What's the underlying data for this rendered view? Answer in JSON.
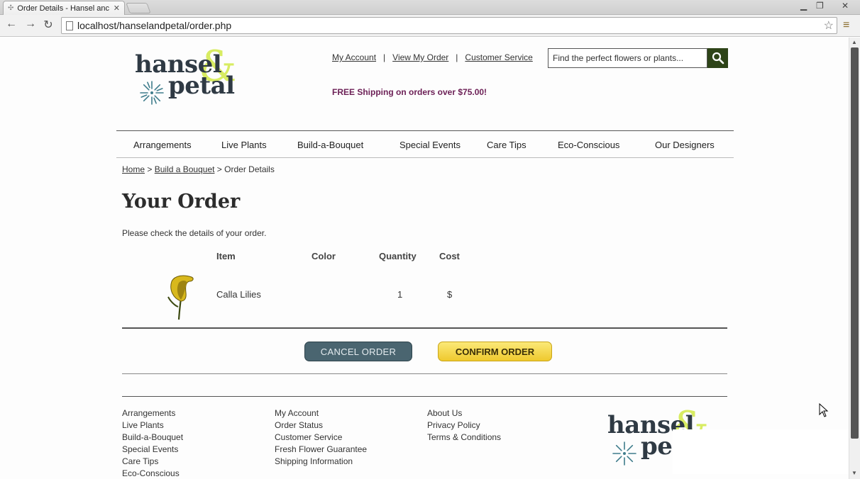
{
  "browser": {
    "tab_title": "Order Details - Hansel anc",
    "url": "localhost/hanselandpetal/order.php",
    "icons": [
      "back-arrow-icon",
      "forward-arrow-icon",
      "reload-icon",
      "star-icon",
      "menu-icon"
    ]
  },
  "header": {
    "logo": {
      "word1": "hansel",
      "ampersand": "&",
      "word2": "petal"
    },
    "links": [
      "My Account",
      "View My Order",
      "Customer Service"
    ],
    "separator": "|",
    "search_placeholder": "Find the perfect flowers or plants...",
    "promo": "FREE Shipping on orders over $75.00!"
  },
  "nav": {
    "items": [
      "Arrangements",
      "Live Plants",
      "Build-a-Bouquet",
      "Special Events",
      "Care Tips",
      "Eco-Conscious",
      "Our Designers"
    ]
  },
  "breadcrumb": {
    "home": "Home",
    "parent": "Build a Bouquet",
    "current": "Order Details",
    "sep": ">"
  },
  "main": {
    "title": "Your Order",
    "intro": "Please check the details of your order.",
    "table": {
      "headers": {
        "item": "Item",
        "color": "Color",
        "quantity": "Quantity",
        "cost": "Cost"
      },
      "rows": [
        {
          "item": "Calla Lilies",
          "color": "",
          "quantity": "1",
          "cost": "$"
        }
      ]
    },
    "cancel_label": "CANCEL ORDER",
    "confirm_label": "CONFIRM ORDER"
  },
  "footer": {
    "col1": [
      "Arrangements",
      "Live Plants",
      "Build-a-Bouquet",
      "Special Events",
      "Care Tips",
      "Eco-Conscious"
    ],
    "col2": [
      "My Account",
      "Order Status",
      "Customer Service",
      "Fresh Flower Guarantee",
      "Shipping Information"
    ],
    "col3": [
      "About Us",
      "Privacy Policy",
      "Terms & Conditions"
    ]
  },
  "colors": {
    "promo": "#6d2157",
    "search_button": "#2e4418",
    "cancel_button": "#4a6570",
    "confirm_button": "#efc92e",
    "logo_ampersand": "#d8ec62"
  }
}
